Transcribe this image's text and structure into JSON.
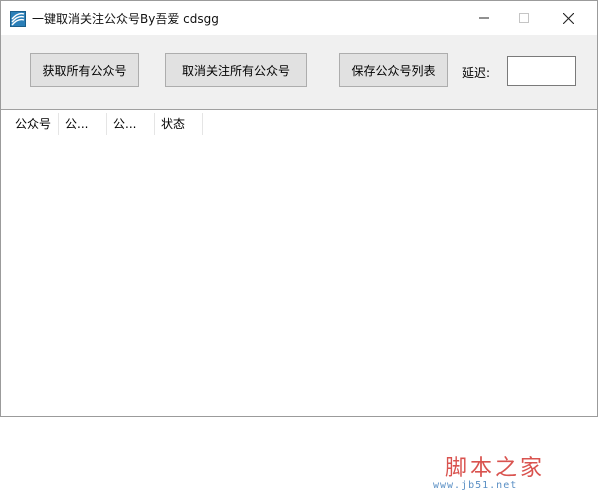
{
  "window": {
    "title": "一键取消关注公众号By吾爱 cdsgg",
    "icon": "app-icon"
  },
  "toolbar": {
    "fetch_label": "获取所有公众号",
    "unfollow_label": "取消关注所有公众号",
    "save_label": "保存公众号列表",
    "delay_label": "延迟:",
    "delay_value": ""
  },
  "list": {
    "columns": [
      "公众号",
      "公...",
      "公...",
      "状态"
    ],
    "rows": []
  },
  "watermark": {
    "title": "脚本之家",
    "url": "www.jb51.net"
  }
}
